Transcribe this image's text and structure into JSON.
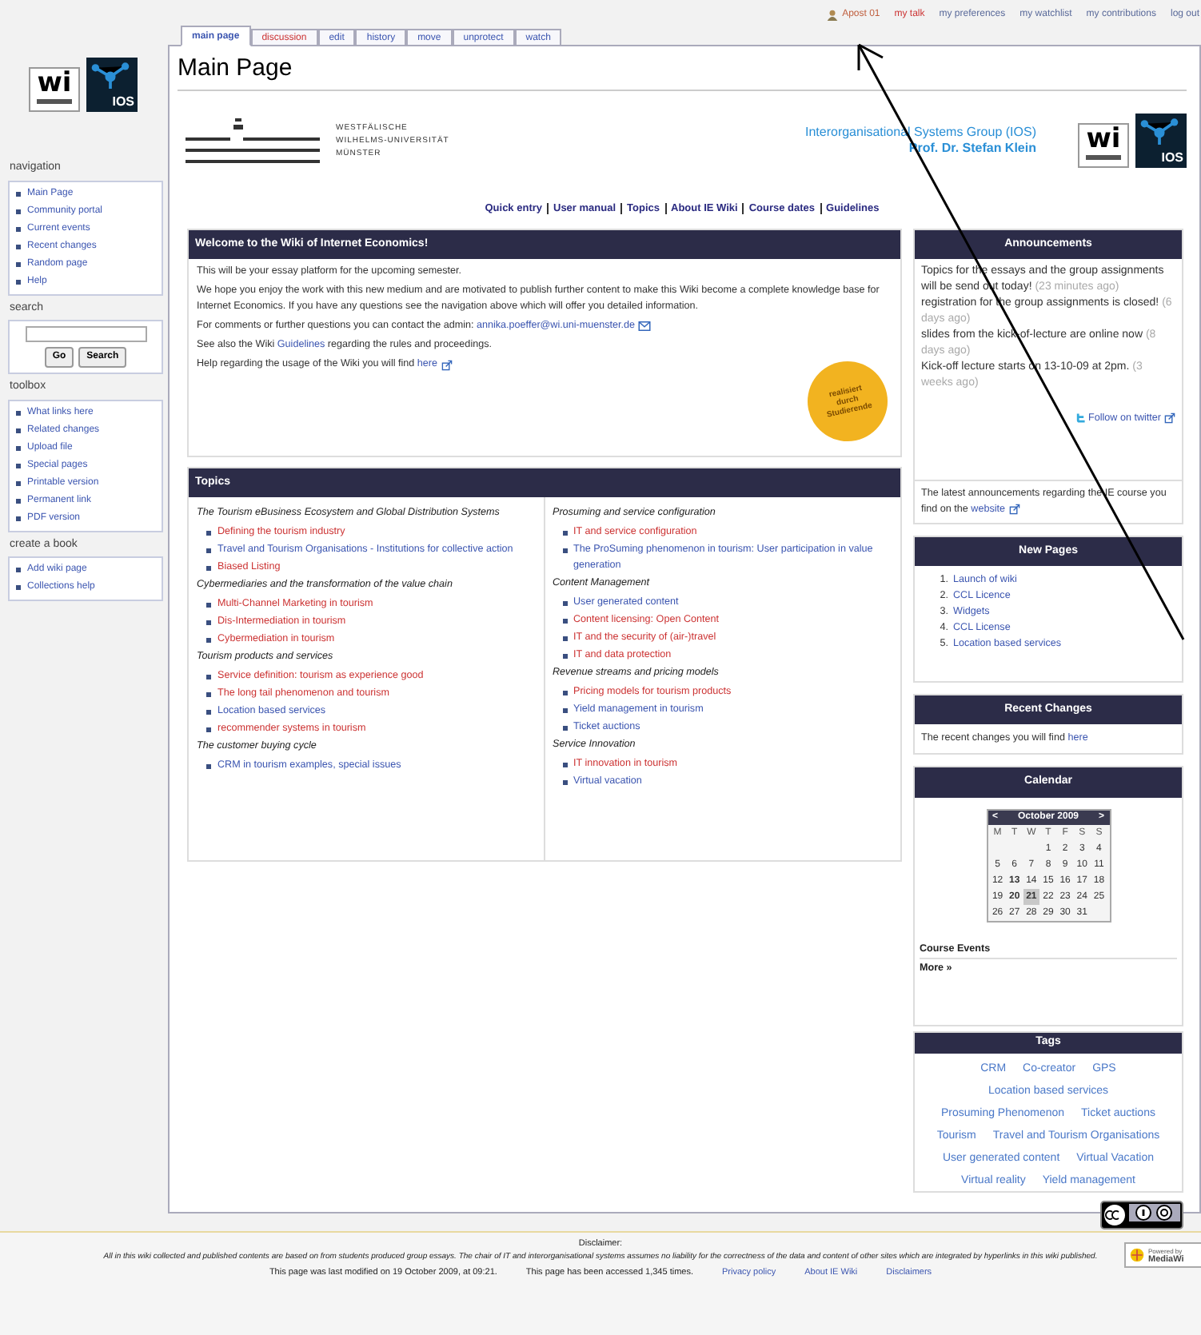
{
  "personal_bar": {
    "user": "Apost 01",
    "links": [
      {
        "label": "my talk",
        "missing": true
      },
      {
        "label": "my preferences",
        "missing": false
      },
      {
        "label": "my watchlist",
        "missing": false
      },
      {
        "label": "my contributions",
        "missing": false
      },
      {
        "label": "log out",
        "missing": false
      }
    ]
  },
  "tabs": [
    {
      "label": "main page",
      "selected": true,
      "missing": false
    },
    {
      "label": "discussion",
      "selected": false,
      "missing": true
    },
    {
      "label": "edit",
      "selected": false,
      "missing": false
    },
    {
      "label": "history",
      "selected": false,
      "missing": false
    },
    {
      "label": "move",
      "selected": false,
      "missing": false
    },
    {
      "label": "unprotect",
      "selected": false,
      "missing": false
    },
    {
      "label": "watch",
      "selected": false,
      "missing": false
    }
  ],
  "sidebar_logo": {
    "wi": "wi",
    "ios": "IOS"
  },
  "sidebar": [
    {
      "title": "navigation",
      "kind": "links",
      "items": [
        "Main Page",
        "Community portal",
        "Current events",
        "Recent changes",
        "Random page",
        "Help"
      ]
    },
    {
      "title": "search",
      "kind": "search",
      "buttons": [
        "Go",
        "Search"
      ]
    },
    {
      "title": "toolbox",
      "kind": "links",
      "items": [
        "What links here",
        "Related changes",
        "Upload file",
        "Special pages",
        "Printable version",
        "Permanent link",
        "PDF version"
      ]
    },
    {
      "title": "create a book",
      "kind": "links",
      "items": [
        "Add wiki page",
        "Collections help"
      ]
    }
  ],
  "page_title": "Main Page",
  "banner": {
    "logo": {
      "wi": "wi",
      "ios": "IOS"
    },
    "university": [
      "WESTFÄLISCHE",
      "WILHELMS-UNIVERSITÄT",
      "MÜNSTER"
    ],
    "group": "Interorganisational Systems Group (IOS)",
    "professor": "Prof. Dr. Stefan Klein"
  },
  "quick_links": [
    "Quick entry",
    "User manual",
    "Topics",
    "About IE Wiki",
    "Course dates",
    "Guidelines"
  ],
  "welcome": {
    "title": "Welcome to the Wiki of Internet Economics!",
    "paragraphs": [
      [
        {
          "kind": "text",
          "text": "This will be your essay platform for the upcoming semester."
        }
      ],
      [
        {
          "kind": "text",
          "text": "We hope you enjoy the work with this new medium and are motivated to publish further content to make this Wiki become a complete knowledge base for Internet Economics. If you have any questions see the navigation above which will offer you detailed information."
        }
      ],
      [
        {
          "kind": "text",
          "text": "For comments or further questions you can contact the admin: "
        },
        {
          "kind": "mail",
          "text": "annika.poeffer@wi.uni-muenster.de"
        }
      ],
      [
        {
          "kind": "text",
          "text": "See also the Wiki "
        },
        {
          "kind": "internal",
          "text": "Guidelines"
        },
        {
          "kind": "text",
          "text": " regarding the rules and proceedings."
        }
      ],
      [
        {
          "kind": "text",
          "text": "Help regarding the usage of the Wiki you will find "
        },
        {
          "kind": "external",
          "text": "here"
        }
      ]
    ],
    "sticker": [
      "realisiert",
      "durch",
      "Studierende"
    ]
  },
  "topics": {
    "title": "Topics",
    "columns": [
      [
        {
          "heading": "The Tourism eBusiness Ecosystem and Global Distribution Systems",
          "items": [
            {
              "label": "Defining the tourism industry",
              "missing": true
            },
            {
              "label": "Travel and Tourism Organisations - Institutions for collective action",
              "missing": false
            },
            {
              "label": "Biased Listing",
              "missing": true
            }
          ]
        },
        {
          "heading": "Cybermediaries and the transformation of the value chain",
          "items": [
            {
              "label": "Multi-Channel Marketing in tourism",
              "missing": true
            },
            {
              "label": "Dis-Intermediation in tourism",
              "missing": true
            },
            {
              "label": "Cybermediation in tourism",
              "missing": true
            }
          ]
        },
        {
          "heading": "Tourism products and services",
          "items": [
            {
              "label": "Service definition: tourism as experience good",
              "missing": true
            },
            {
              "label": "The long tail phenomenon and tourism",
              "missing": true
            },
            {
              "label": "Location based services",
              "missing": false
            },
            {
              "label": "recommender systems in tourism",
              "missing": true
            }
          ]
        },
        {
          "heading": "The customer buying cycle",
          "items": [
            {
              "label": "CRM in tourism examples, special issues",
              "missing": false
            }
          ]
        }
      ],
      [
        {
          "heading": "Prosuming and service configuration",
          "items": [
            {
              "label": "IT and service configuration",
              "missing": true
            },
            {
              "label": "The ProSuming phenomenon in tourism: User participation in value generation",
              "missing": false
            }
          ]
        },
        {
          "heading": "Content Management",
          "items": [
            {
              "label": "User generated content",
              "missing": false
            },
            {
              "label": "Content licensing: Open Content",
              "missing": true
            },
            {
              "label": "IT and the security of (air-)travel",
              "missing": true
            },
            {
              "label": "IT and data protection",
              "missing": true
            }
          ]
        },
        {
          "heading": "Revenue streams and pricing models",
          "items": [
            {
              "label": "Pricing models for tourism products",
              "missing": true
            },
            {
              "label": "Yield management in tourism",
              "missing": false
            },
            {
              "label": "Ticket auctions",
              "missing": false
            }
          ]
        },
        {
          "heading": "Service Innovation",
          "items": [
            {
              "label": "IT innovation in tourism",
              "missing": true
            },
            {
              "label": "Virtual vacation",
              "missing": false
            }
          ]
        }
      ]
    ]
  },
  "announcements": {
    "title": "Announcements",
    "items": [
      {
        "text": "Topics for the essays and the group assignments will be send out today!",
        "age": "(23 minutes ago)"
      },
      {
        "text": "registration for the group assignments is closed!",
        "age": "(6 days ago)"
      },
      {
        "text": "slides from the kick-of-lecture are online now",
        "age": "(8 days ago)"
      },
      {
        "text": "Kick-off lecture starts on 13-10-09 at 2pm.",
        "age": "(3 weeks ago)"
      }
    ],
    "twitter": "Follow on twitter",
    "note": "The latest announcements regarding the IE course you find on the ",
    "note_link": "website"
  },
  "new_pages": {
    "title": "New Pages",
    "items": [
      {
        "number": "1.",
        "label": "Launch of wiki"
      },
      {
        "number": "2.",
        "label": "CCL Licence"
      },
      {
        "number": "3.",
        "label": "Widgets"
      },
      {
        "number": "4.",
        "label": "CCL License"
      },
      {
        "number": "5.",
        "label": "Location based services"
      }
    ]
  },
  "recent_changes": {
    "title": "Recent Changes",
    "text": "The recent changes you will find ",
    "link": "here"
  },
  "calendar": {
    "title": "Calendar",
    "prev": "<",
    "next": ">",
    "month": "October 2009",
    "weekdays": [
      "M",
      "T",
      "W",
      "T",
      "F",
      "S",
      "S"
    ],
    "weeks": [
      [
        {
          "day": "1",
          "event": false,
          "selected": false
        },
        {
          "day": "2",
          "event": false,
          "selected": false
        },
        {
          "day": "3",
          "event": false,
          "selected": false
        },
        {
          "day": "4",
          "event": false,
          "selected": false
        }
      ],
      [
        {
          "day": "5",
          "event": false,
          "selected": false
        },
        {
          "day": "6",
          "event": false,
          "selected": false
        },
        {
          "day": "7",
          "event": false,
          "selected": false
        },
        {
          "day": "8",
          "event": false,
          "selected": false
        },
        {
          "day": "9",
          "event": false,
          "selected": false
        },
        {
          "day": "10",
          "event": false,
          "selected": false
        },
        {
          "day": "11",
          "event": false,
          "selected": false
        }
      ],
      [
        {
          "day": "12",
          "event": false,
          "selected": false
        },
        {
          "day": "13",
          "event": true,
          "selected": false
        },
        {
          "day": "14",
          "event": false,
          "selected": false
        },
        {
          "day": "15",
          "event": false,
          "selected": false
        },
        {
          "day": "16",
          "event": false,
          "selected": false
        },
        {
          "day": "17",
          "event": false,
          "selected": false
        },
        {
          "day": "18",
          "event": false,
          "selected": false
        }
      ],
      [
        {
          "day": "19",
          "event": false,
          "selected": false
        },
        {
          "day": "20",
          "event": true,
          "selected": false
        },
        {
          "day": "21",
          "event": true,
          "selected": true
        },
        {
          "day": "22",
          "event": false,
          "selected": false
        },
        {
          "day": "23",
          "event": false,
          "selected": false
        },
        {
          "day": "24",
          "event": false,
          "selected": false
        },
        {
          "day": "25",
          "event": false,
          "selected": false
        }
      ],
      [
        {
          "day": "26",
          "event": false,
          "selected": false
        },
        {
          "day": "27",
          "event": false,
          "selected": false
        },
        {
          "day": "28",
          "event": false,
          "selected": false
        },
        {
          "day": "29",
          "event": false,
          "selected": false
        },
        {
          "day": "30",
          "event": false,
          "selected": false
        },
        {
          "day": "31",
          "event": false,
          "selected": false
        }
      ]
    ],
    "events_label": "Course Events",
    "more": "More »"
  },
  "tags": {
    "title": "Tags",
    "items": [
      "CRM",
      "Co-creator",
      "GPS",
      "Location based services",
      "Prosuming Phenomenon",
      "Ticket auctions",
      "Tourism",
      "Travel and Tourism Organisations",
      "User generated content",
      "Virtual Vacation",
      "Virtual reality",
      "Yield management"
    ]
  },
  "footer": {
    "disclaimer_label": "Disclaimer:",
    "disclaimer": "All in this wiki collected and published contents are based on from students produced group essays. The chair of IT and interorganisational systems assumes no liability for the correctness of the data and content of other sites which are integrated by hyperlinks in this wiki published.",
    "modified": "This page was last modified on 19 October 2009, at 09:21.",
    "accessed": "This page has been accessed 1,345 times.",
    "links": [
      "Privacy policy",
      "About IE Wiki",
      "Disclaimers"
    ],
    "powered": [
      "Powered by",
      "MediaWi"
    ]
  },
  "annotation": {
    "kind": "arrow"
  }
}
